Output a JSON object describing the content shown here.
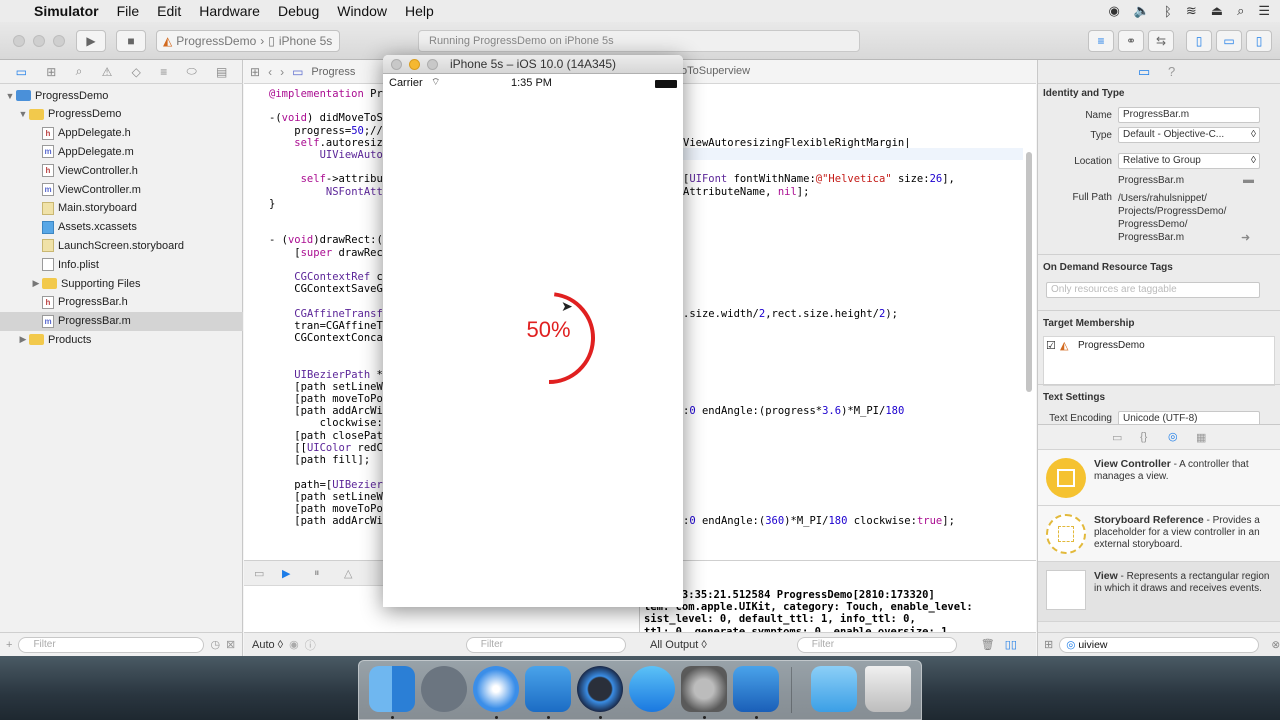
{
  "menubar": {
    "app_name": "Simulator",
    "items": [
      "File",
      "Edit",
      "Hardware",
      "Debug",
      "Window",
      "Help"
    ]
  },
  "toolbar": {
    "scheme": "ProgressDemo",
    "device": "iPhone 5s",
    "activity": "Running ProgressDemo on iPhone 5s"
  },
  "navigator": {
    "items": [
      {
        "label": "ProgressDemo",
        "kind": "project"
      },
      {
        "label": "ProgressDemo",
        "kind": "folder"
      },
      {
        "label": "AppDelegate.h",
        "kind": "h"
      },
      {
        "label": "AppDelegate.m",
        "kind": "m"
      },
      {
        "label": "ViewController.h",
        "kind": "h"
      },
      {
        "label": "ViewController.m",
        "kind": "m"
      },
      {
        "label": "Main.storyboard",
        "kind": "storyboard"
      },
      {
        "label": "Assets.xcassets",
        "kind": "assets"
      },
      {
        "label": "LaunchScreen.storyboard",
        "kind": "storyboard"
      },
      {
        "label": "Info.plist",
        "kind": "plist"
      },
      {
        "label": "Supporting Files",
        "kind": "folder"
      },
      {
        "label": "ProgressBar.h",
        "kind": "h"
      },
      {
        "label": "ProgressBar.m",
        "kind": "m",
        "selected": true
      },
      {
        "label": "Products",
        "kind": "folder"
      }
    ],
    "filter_placeholder": "Filter"
  },
  "editor": {
    "jump_file": "Progress",
    "jump_method": "oToSuperview",
    "code_left": [
      "@implementation Pr",
      "",
      "-(void) didMoveToS",
      "    progress=50;//",
      "    self.autoresiz",
      "        UIViewAuto",
      "",
      "     self->attribu",
      "         NSFontAtt",
      "}",
      "",
      "",
      "- (void)drawRect:(",
      "    [super drawRec",
      "",
      "    CGContextRef c",
      "    CGContextSaveG",
      "",
      "    CGAffineTransf",
      "    tran=CGAffineT",
      "    CGContextConca",
      "",
      "",
      "    UIBezierPath *",
      "    [path setLineW",
      "    [path moveToPo",
      "    [path addArcWi",
      "        clockwise:",
      "    [path closePat",
      "    [[UIColor redC",
      "    [path fill];",
      "",
      "    path=[UIBezier",
      "    [path setLineW",
      "    [path moveToPo",
      "    [path addArcWi"
    ],
    "code_right": [
      {
        "row": 4,
        "text": "ViewAutoresizingFlexibleRightMargin|"
      },
      {
        "row": 5,
        "text": "xibleBottomMargin;"
      },
      {
        "row": 7,
        "text": "[UIFont fontWithName:@\"Helvetica\" size:26],"
      },
      {
        "row": 8,
        "text": "AttributeName, nil];"
      },
      {
        "row": 18,
        "text": ".size.width/2,rect.size.height/2);"
      },
      {
        "row": 26,
        "text": ":0 endAngle:(progress*3.6)*M_PI/180"
      },
      {
        "row": 35,
        "text": ":0 endAngle:(360)*M_PI/180 clockwise:true];"
      }
    ],
    "console_lines": [
      "9-15 13:35:21.512584 ProgressDemo[2810:173320]",
      "tem: com.apple.UIKit, category: Touch, enable_level:",
      "sist_level: 0, default_ttl: 1, info_ttl: 0,",
      "ttl: 0, generate_symptoms: 0, enable_oversize: 1,",
      "privacy_setting: 2, enable_private_data: 0"
    ],
    "auto_label": "Auto ◊",
    "filter_placeholder": "Filter",
    "all_output": "All Output ◊"
  },
  "inspector": {
    "identity_header": "Identity and Type",
    "name_label": "Name",
    "name_value": "ProgressBar.m",
    "type_label": "Type",
    "type_value": "Default - Objective-C...",
    "location_label": "Location",
    "location_value": "Relative to Group",
    "location_file": "ProgressBar.m",
    "fullpath_label": "Full Path",
    "fullpath_lines": [
      "/Users/rahulsnippet/",
      "Projects/ProgressDemo/",
      "ProgressDemo/",
      "ProgressBar.m"
    ],
    "ondemand_header": "On Demand Resource Tags",
    "ondemand_placeholder": "Only resources are taggable",
    "target_header": "Target Membership",
    "target_name": "ProgressDemo",
    "text_header": "Text Settings",
    "encoding_label": "Text Encoding",
    "encoding_value": "Unicode (UTF-8)",
    "library": [
      {
        "title": "View Controller",
        "desc": " - A controller that manages a view."
      },
      {
        "title": "Storyboard Reference",
        "desc": " - Provides a placeholder for a view controller in an external storyboard."
      },
      {
        "title": "View",
        "desc": " - Represents a rectangular region in which it draws and receives events."
      }
    ],
    "search_value": "uiview"
  },
  "simulator": {
    "title": "iPhone 5s – iOS 10.0 (14A345)",
    "carrier": "Carrier",
    "time": "1:35 PM",
    "progress_text": "50%",
    "progress_value": 50,
    "progress_color": "#e02020"
  },
  "dock": {
    "apps": [
      "finder-icon",
      "launchpad-icon",
      "safari-icon",
      "xcode-icon",
      "quicktime-icon",
      "app-store-icon",
      "system-preferences-icon",
      "simulator-icon",
      "downloads-icon",
      "trash-icon"
    ]
  }
}
